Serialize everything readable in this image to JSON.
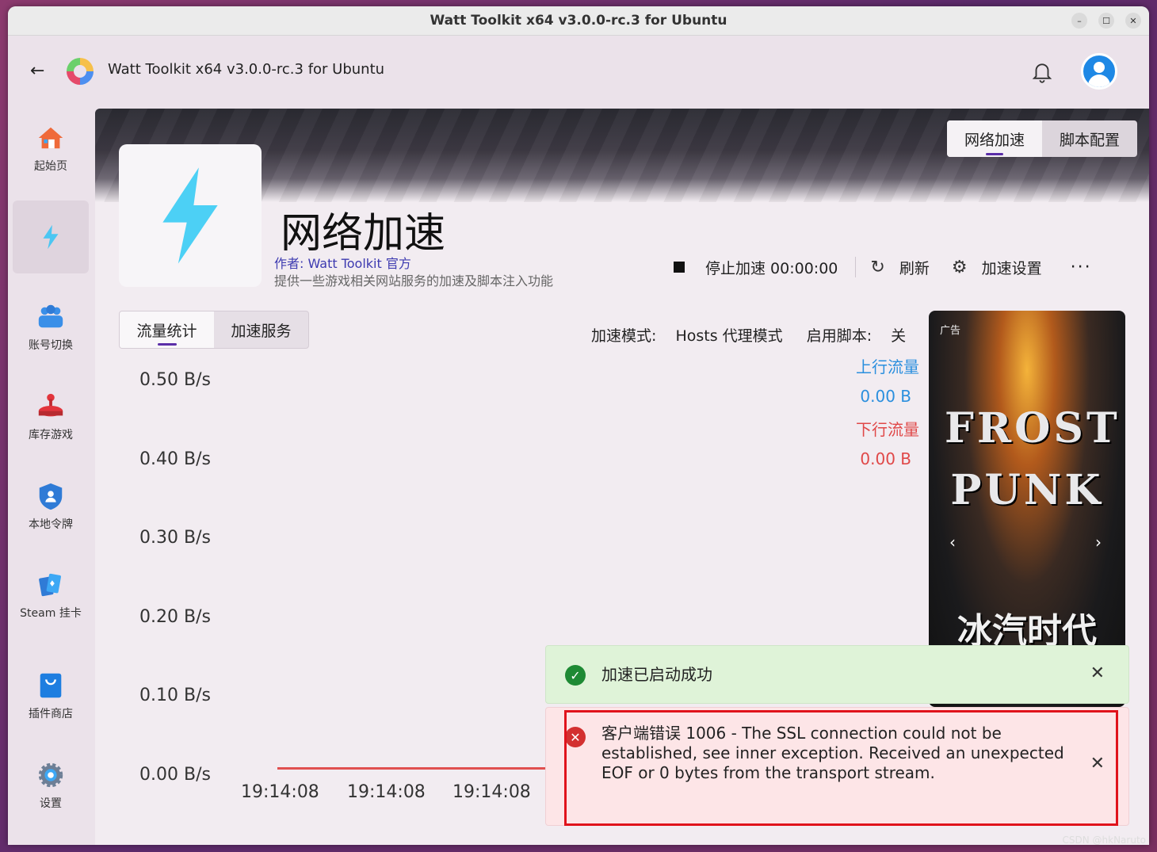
{
  "window": {
    "title": "Watt Toolkit x64 v3.0.0-rc.3 for Ubuntu",
    "controls": [
      "–",
      "☐",
      "✕"
    ]
  },
  "appbar": {
    "title": "Watt Toolkit x64 v3.0.0-rc.3 for Ubuntu"
  },
  "sidebar": {
    "items": [
      {
        "label": "起始页",
        "icon": "home-icon"
      },
      {
        "label": "",
        "icon": "lightning-icon",
        "active": true
      },
      {
        "label": "账号切换",
        "icon": "users-icon"
      },
      {
        "label": "库存游戏",
        "icon": "joystick-icon"
      },
      {
        "label": "本地令牌",
        "icon": "shield-icon"
      },
      {
        "label": "Steam 挂卡",
        "icon": "cards-icon"
      },
      {
        "label": "插件商店",
        "icon": "store-bag-icon"
      },
      {
        "label": "设置",
        "icon": "gear-icon"
      }
    ]
  },
  "header_tabs": [
    "网络加速",
    "脚本配置"
  ],
  "plugin": {
    "title": "网络加速",
    "author": "作者:  Watt Toolkit  官方",
    "description": "提供一些游戏相关网站服务的加速及脚本注入功能"
  },
  "actions": {
    "stop": "停止加速 00:00:00",
    "refresh": "刷新",
    "settings": "加速设置",
    "more": "···"
  },
  "sub_tabs": [
    "流量统计",
    "加速服务"
  ],
  "mode": {
    "mode_label": "加速模式:",
    "mode_value": "Hosts 代理模式",
    "script_label": "启用脚本:",
    "script_value": "关"
  },
  "legend": {
    "up_name": "上行流量",
    "up_value": "0.00 B",
    "down_name": "下行流量",
    "down_value": "0.00 B"
  },
  "chart_data": {
    "type": "line",
    "x": [
      "19:14:08",
      "19:14:08",
      "19:14:08"
    ],
    "y_ticks": [
      "0.50 B/s",
      "0.40 B/s",
      "0.30 B/s",
      "0.20 B/s",
      "0.10 B/s",
      "0.00 B/s"
    ],
    "ylim": [
      0,
      0.5
    ],
    "series": [
      {
        "name": "上行流量",
        "values": [
          0,
          0,
          0
        ],
        "color": "#2b8fde"
      },
      {
        "name": "下行流量",
        "values": [
          0,
          0,
          0
        ],
        "color": "#e04848"
      }
    ]
  },
  "ad": {
    "tag": "广告",
    "logo_text": "FROST PUNK",
    "cn_text": "冰汽时代"
  },
  "toasts": {
    "success": "加速已启动成功",
    "error": "客户端错误 1006 - The SSL connection could not be established, see inner exception. Received an unexpected EOF or 0 bytes from the transport stream."
  },
  "watermark": "CSDN @hkNaruto",
  "colors": {
    "accent": "#5b2ea8",
    "up": "#2b8fde",
    "down": "#e04848",
    "success_bg": "#dff3d8",
    "error_bg": "#fde5e7",
    "error_outline": "#e0131c"
  }
}
